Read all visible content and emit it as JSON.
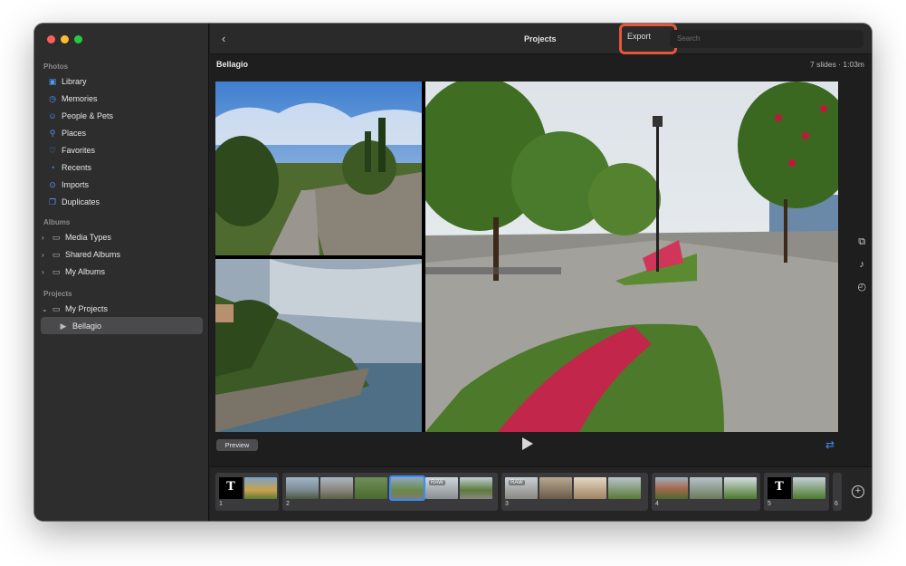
{
  "sidebar": {
    "section_photos": "Photos",
    "photos_items": [
      {
        "label": "Library",
        "icon": "library-icon"
      },
      {
        "label": "Memories",
        "icon": "memories-icon"
      },
      {
        "label": "People & Pets",
        "icon": "people-icon"
      },
      {
        "label": "Places",
        "icon": "places-icon"
      },
      {
        "label": "Favorites",
        "icon": "heart-icon"
      },
      {
        "label": "Recents",
        "icon": "clock-icon"
      },
      {
        "label": "Imports",
        "icon": "imports-icon"
      },
      {
        "label": "Duplicates",
        "icon": "duplicates-icon"
      }
    ],
    "section_albums": "Albums",
    "album_items": [
      {
        "label": "Media Types"
      },
      {
        "label": "Shared Albums"
      },
      {
        "label": "My Albums"
      }
    ],
    "section_projects": "Projects",
    "project_group": "My Projects",
    "project_item": "Bellagio"
  },
  "toolbar": {
    "title": "Projects",
    "export_label": "Export",
    "search_placeholder": "Search"
  },
  "project": {
    "name": "Bellagio",
    "info": "7 slides · 1:03m"
  },
  "controls": {
    "preview_label": "Preview"
  },
  "filmstrip": {
    "groups": [
      {
        "number": "1",
        "title_letter": "T"
      },
      {
        "number": "2"
      },
      {
        "number": "3",
        "raw_label": "RAW"
      },
      {
        "number": "4"
      },
      {
        "number": "5",
        "title_letter": "T"
      },
      {
        "number": "6"
      }
    ],
    "raw_label_2": "RAW"
  },
  "colors": {
    "accent": "#3b8ef5",
    "export_highlight": "#e5563a"
  }
}
